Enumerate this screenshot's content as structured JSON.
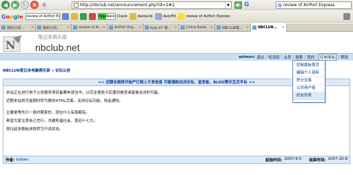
{
  "browser": {
    "url": "http://nbclub.net/announcement.php?id=2#2",
    "search_value": "review of AirPort Express"
  },
  "bookmarks_bar": {
    "search_value": "review of AirPort Exp",
    "pagerank_label": "PageRank",
    "check_label": "Check",
    "autolink_label": "AutoLink",
    "autofill_label": "AutoFill",
    "review_label": "review",
    "of_label": "of",
    "airport_label": "AirPort",
    "express_label": "Express"
  },
  "tabs": [
    {
      "label": "我的订阅…"
    },
    {
      "label": "我的订阅…"
    },
    {
      "label": "review of Ai…"
    },
    {
      "label": "AirPort Exp…"
    },
    {
      "label": "Kyle.XY 博…"
    },
    {
      "label": "China News…"
    },
    {
      "label": "NBCLUB笔…"
    },
    {
      "label": "NBCLUB…",
      "active": true
    }
  ],
  "site": {
    "logo_cn": "笔记本俱乐部",
    "logo_en": "nbclub.net"
  },
  "userbar": {
    "username": "asimov:",
    "items": [
      "退出",
      "短消息",
      "会员",
      "搜索",
      "我的",
      "控制面板",
      "帮助"
    ]
  },
  "dropdown": {
    "items": [
      "控制面板首页",
      "编辑个人资料",
      "积分交易",
      "公共用户组",
      "好友列表"
    ]
  },
  "breadcrumb": "NBCLUB笔记本电脑俱乐部 » 论坛公告",
  "announcement": {
    "title": "<< 近期全面将开始严打网上不良信息 可能强制关闭论坛、留言板、BLOG等交互式平台 >>",
    "paragraphs": [
      "本站正在进行电子公告服务项目备案申请当中，以完全避免今后遭到被查或者被关闭的可能。",
      "近期本站将可能随时转为静态HTML页面，关闭论坛功能，特此通知。",
      "主要是等先行一段时期来的，现在什么有局都有。",
      "希望大家注意自己言行，共建和谐社会，喜迎十七大。",
      "即日起多数板块将转为只读状态。"
    ]
  },
  "footer": {
    "author_label": "作者:",
    "author": "bobwu",
    "start_label": "起始时间:",
    "start": "2007-9-5",
    "end_label": "结束时间:",
    "end": "2007-10-8"
  }
}
